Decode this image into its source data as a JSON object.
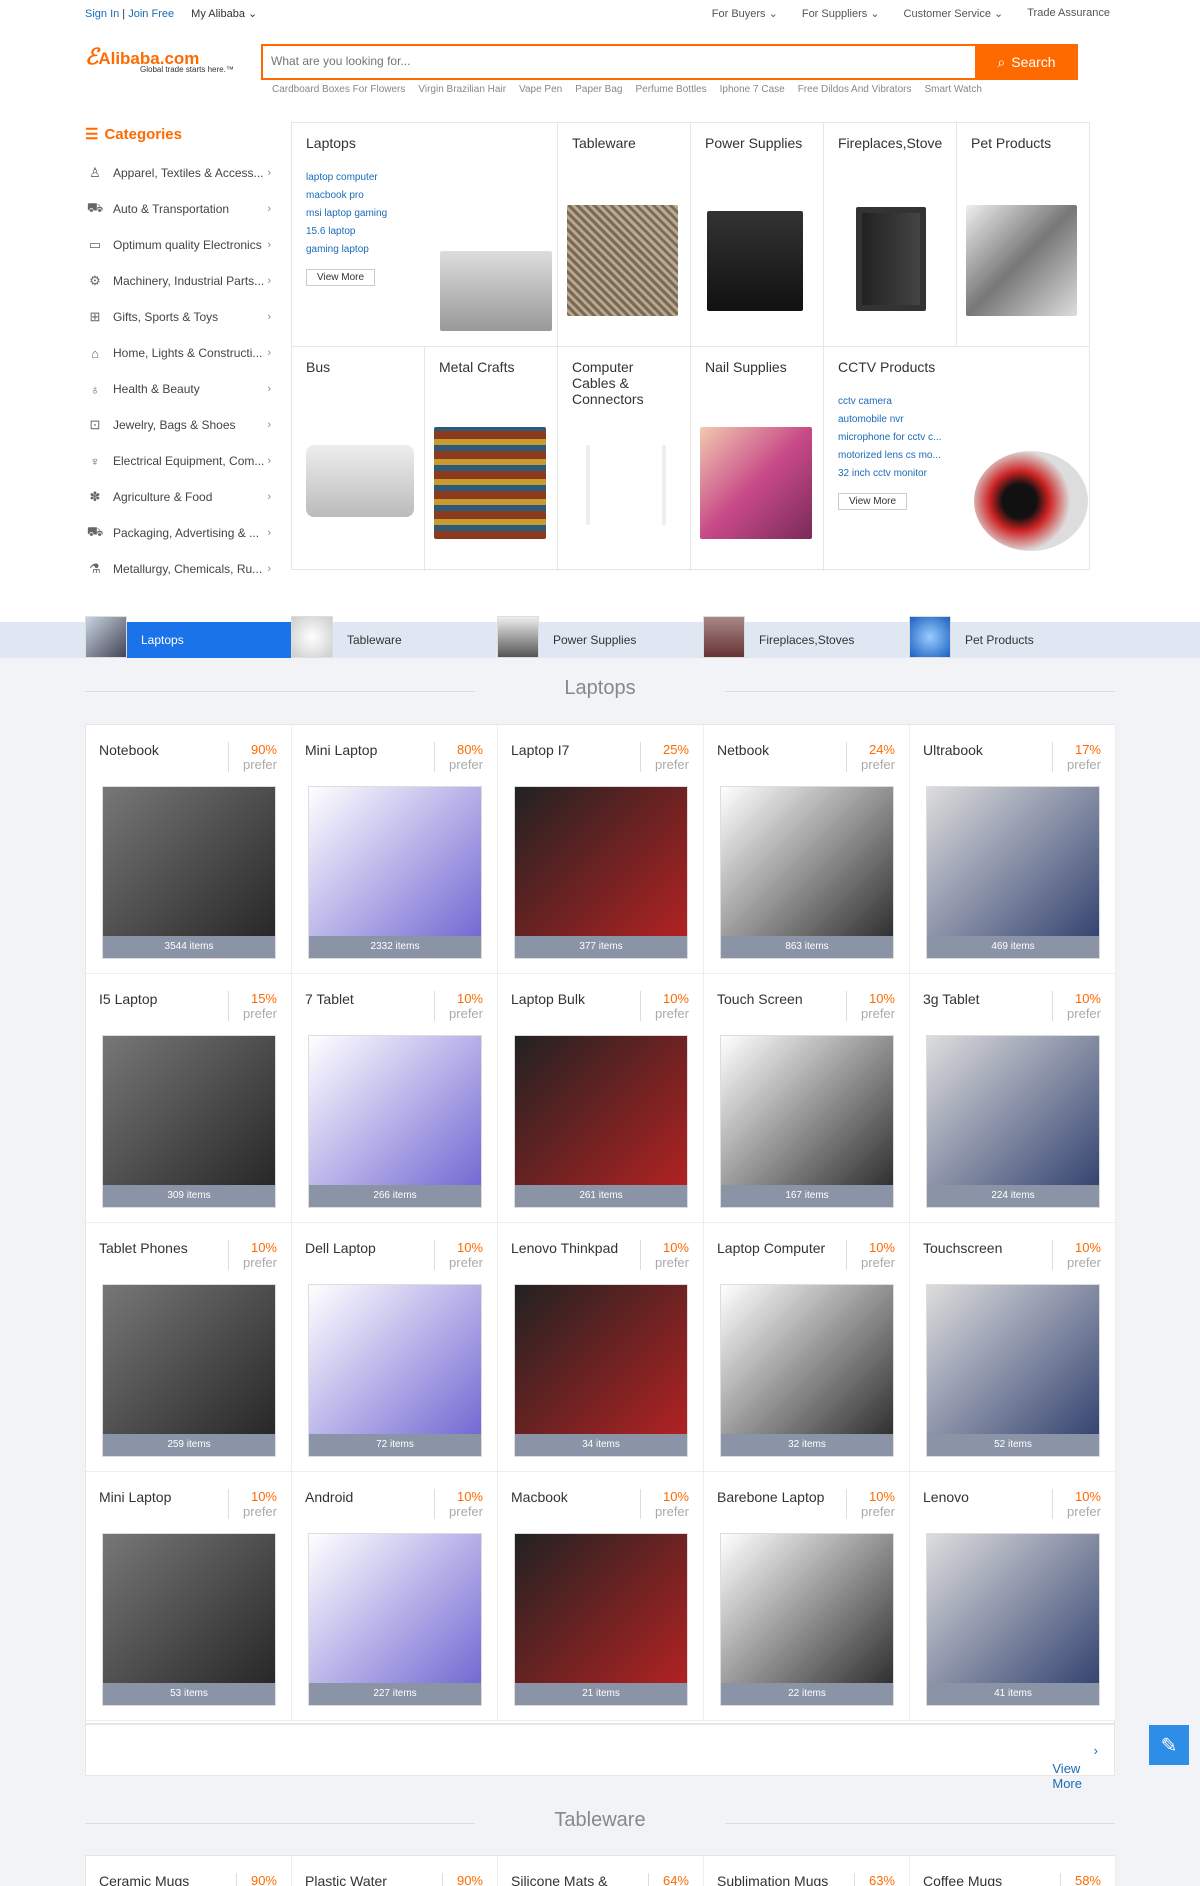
{
  "topbar": {
    "signin": "Sign In",
    "join": "Join Free",
    "my": "My Alibaba",
    "buyers": "For Buyers",
    "suppliers": "For Suppliers",
    "service": "Customer Service",
    "assurance": "Trade Assurance"
  },
  "logo": {
    "name": "Alibaba.com",
    "tagline": "Global trade starts here.™"
  },
  "search": {
    "placeholder": "What are you looking for...",
    "button": "Search"
  },
  "hot": [
    "Cardboard Boxes For Flowers",
    "Virgin Brazilian Hair",
    "Vape Pen",
    "Paper Bag",
    "Perfume Bottles",
    "Iphone 7 Case",
    "Free Dildos And Vibrators",
    "Smart Watch"
  ],
  "categories": {
    "title": "Categories",
    "items": [
      "Apparel, Textiles & Access...",
      "Auto & Transportation",
      "Optimum quality Electronics",
      "Machinery, Industrial Parts...",
      "Gifts, Sports & Toys",
      "Home, Lights & Constructi...",
      "Health & Beauty",
      "Jewelry, Bags & Shoes",
      "Electrical Equipment, Com...",
      "Agriculture & Food",
      "Packaging, Advertising & ...",
      "Metallurgy, Chemicals, Ru..."
    ]
  },
  "featured": {
    "laptops": {
      "title": "Laptops",
      "links": [
        "laptop computer",
        "macbook pro",
        "msi laptop gaming",
        "15.6 laptop",
        "gaming laptop"
      ],
      "more": "View More"
    },
    "tableware": "Tableware",
    "power": "Power Supplies",
    "fire": "Fireplaces,Stoves",
    "pet": "Pet Products",
    "bus": "Bus",
    "metal": "Metal Crafts",
    "cables": "Computer Cables & Connectors",
    "nail": "Nail Supplies",
    "cctv": {
      "title": "CCTV Products",
      "links": [
        "cctv camera",
        "automobile nvr",
        "microphone for cctv c...",
        "motorized lens cs mo...",
        "32 inch cctv monitor"
      ],
      "more": "View More"
    }
  },
  "tabs": [
    "Laptops",
    "Tableware",
    "Power Supplies",
    "Fireplaces,Stoves",
    "Pet Products"
  ],
  "section1": "Laptops",
  "prefer": "prefer",
  "products": [
    {
      "name": "Notebook",
      "pct": "90%",
      "count": "3544 items"
    },
    {
      "name": "Mini Laptop",
      "pct": "80%",
      "count": "2332 items"
    },
    {
      "name": "Laptop I7",
      "pct": "25%",
      "count": "377 items"
    },
    {
      "name": "Netbook",
      "pct": "24%",
      "count": "863 items"
    },
    {
      "name": "Ultrabook",
      "pct": "17%",
      "count": "469 items"
    },
    {
      "name": "I5 Laptop",
      "pct": "15%",
      "count": "309 items"
    },
    {
      "name": "7 Tablet",
      "pct": "10%",
      "count": "266 items"
    },
    {
      "name": "Laptop Bulk",
      "pct": "10%",
      "count": "261 items"
    },
    {
      "name": "Touch Screen",
      "pct": "10%",
      "count": "167 items"
    },
    {
      "name": "3g Tablet",
      "pct": "10%",
      "count": "224 items"
    },
    {
      "name": "Tablet Phones",
      "pct": "10%",
      "count": "259 items"
    },
    {
      "name": "Dell Laptop",
      "pct": "10%",
      "count": "72 items"
    },
    {
      "name": "Lenovo Thinkpad",
      "pct": "10%",
      "count": "34 items"
    },
    {
      "name": "Laptop Computer",
      "pct": "10%",
      "count": "32 items"
    },
    {
      "name": "Touchscreen",
      "pct": "10%",
      "count": "52 items"
    },
    {
      "name": "Mini Laptop",
      "pct": "10%",
      "count": "53 items"
    },
    {
      "name": "Android",
      "pct": "10%",
      "count": "227 items"
    },
    {
      "name": "Macbook",
      "pct": "10%",
      "count": "21 items"
    },
    {
      "name": "Barebone Laptop",
      "pct": "10%",
      "count": "22 items"
    },
    {
      "name": "Lenovo",
      "pct": "10%",
      "count": "41 items"
    }
  ],
  "viewmore": "View More",
  "section2": "Tableware",
  "products2": [
    {
      "name": "Ceramic Mugs",
      "pct": "90%"
    },
    {
      "name": "Plastic Water",
      "pct": "90%"
    },
    {
      "name": "Silicone Mats &",
      "pct": "64%"
    },
    {
      "name": "Sublimation Mugs",
      "pct": "63%"
    },
    {
      "name": "Coffee Mugs",
      "pct": "58%"
    }
  ]
}
